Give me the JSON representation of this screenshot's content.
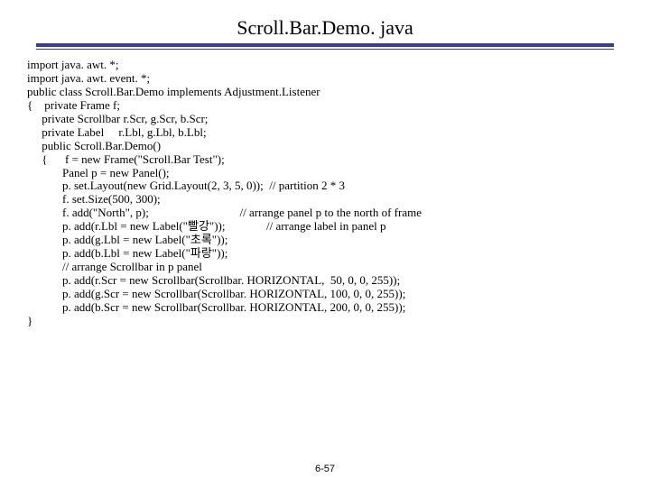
{
  "title": "Scroll.Bar.Demo. java",
  "code": "import java. awt. *;\nimport java. awt. event. *;\npublic class Scroll.Bar.Demo implements Adjustment.Listener\n{    private Frame f;\n     private Scrollbar r.Scr, g.Scr, b.Scr;\n     private Label     r.Lbl, g.Lbl, b.Lbl;\n     public Scroll.Bar.Demo()\n     {      f = new Frame(\"Scroll.Bar Test\");\n            Panel p = new Panel();\n            p. set.Layout(new Grid.Layout(2, 3, 5, 0));  // partition 2 * 3\n            f. set.Size(500, 300);\n            f. add(\"North\", p);                               // arrange panel p to the north of frame\n            p. add(r.Lbl = new Label(\"빨강\"));              // arrange label in panel p\n            p. add(g.Lbl = new Label(\"초록\"));\n            p. add(b.Lbl = new Label(\"파랑\"));\n            // arrange Scrollbar in p panel\n            p. add(r.Scr = new Scrollbar(Scrollbar. HORIZONTAL,  50, 0, 0, 255));\n            p. add(g.Scr = new Scrollbar(Scrollbar. HORIZONTAL, 100, 0, 0, 255));\n            p. add(b.Scr = new Scrollbar(Scrollbar. HORIZONTAL, 200, 0, 0, 255));\n}",
  "page_number": "6-57"
}
